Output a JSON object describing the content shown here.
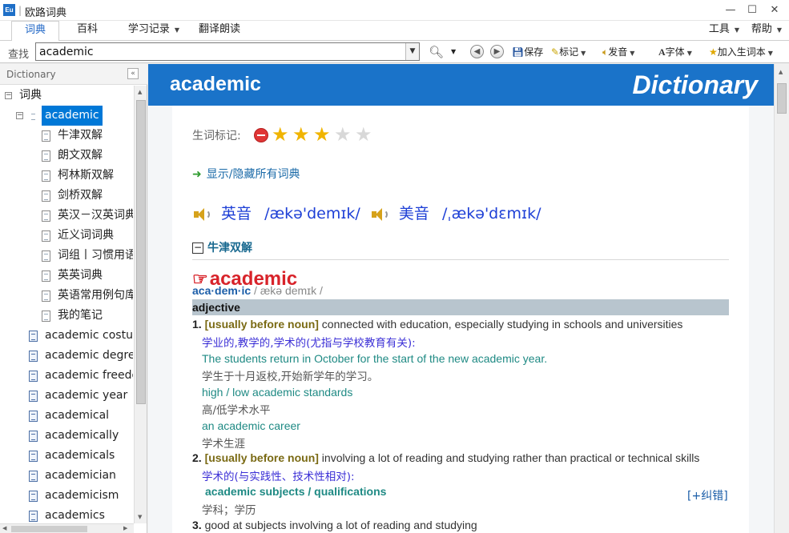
{
  "window": {
    "app_icon_text": "Eu",
    "title": "欧路词典",
    "minimize_glyph": "—",
    "maximize_glyph": "☐",
    "close_glyph": "✕"
  },
  "menu": {
    "tabs": [
      {
        "label": "词典"
      },
      {
        "label": "百科"
      },
      {
        "label": "学习记录"
      },
      {
        "label": "翻译朗读"
      }
    ],
    "tools_label": "工具",
    "help_label": "帮助"
  },
  "toolbar": {
    "search_label": "查找",
    "search_value": "academic",
    "save_label": "保存",
    "mark_label": "标记",
    "speak_label": "发音",
    "font_label": "字体",
    "add_wordbook_label": "加入生词本"
  },
  "sidebar": {
    "header": "Dictionary",
    "root_label": "词典",
    "entry_label": "academic",
    "dict_items": [
      "牛津双解",
      "朗文双解",
      "柯林斯双解",
      "剑桥双解",
      "英汉－汉英词典",
      "近义词词典",
      "词组丨习惯用语",
      "英英词典",
      "英语常用例句库",
      "我的笔记"
    ],
    "word_items": [
      "academic costume",
      "academic degree",
      "academic freedom",
      "academic year",
      "academical",
      "academically",
      "academicals",
      "academician",
      "academicism",
      "academics"
    ]
  },
  "content": {
    "banner_word": "academic",
    "banner_title": "Dictionary",
    "mark_label": "生词标记:",
    "stars_filled": 3,
    "stars_total": 5,
    "toggle_dicts": "显示/隐藏所有词典",
    "uk_label": "英音",
    "uk_ipa": "/ækə'demɪk/",
    "us_label": "美音",
    "us_ipa": "/ˌækə'dɛmɪk/",
    "oxford_title": "牛津双解",
    "headword": "academic",
    "syllabification": "aca·dem·ic",
    "ipa": " / ækə demɪk /",
    "pos": "adjective",
    "senses": {
      "s1_num": "1.",
      "s1_grammar": "[usually before noun]",
      "s1_def_en": " connected with education, especially studying in schools and universities",
      "s1_def_zh": "学业的,教学的,学术的(尤指与学校教育有关):",
      "s1_ex1_en": "The students return in October for the start of the new academic year.",
      "s1_ex1_zh": "学生于十月返校,开始新学年的学习。",
      "s1_ex2_en": "high / low academic standards",
      "s1_ex2_zh": "高/低学术水平",
      "s1_ex3_en": "an academic career",
      "s1_ex3_zh": "学术生涯",
      "s2_num": "2.",
      "s2_grammar": "[usually before noun]",
      "s2_def_en": " involving a lot of reading and studying rather than practical or technical skills",
      "s2_def_zh": "学术的(与实践性、技术性相对):",
      "s2_collo_en": "academic subjects / qualifications",
      "s2_collo_zh": "学科；学历",
      "s3_num": "3.",
      "s3_def_en": " good at subjects involving a lot of reading and studying"
    },
    "correct_link": "[+纠错]"
  }
}
